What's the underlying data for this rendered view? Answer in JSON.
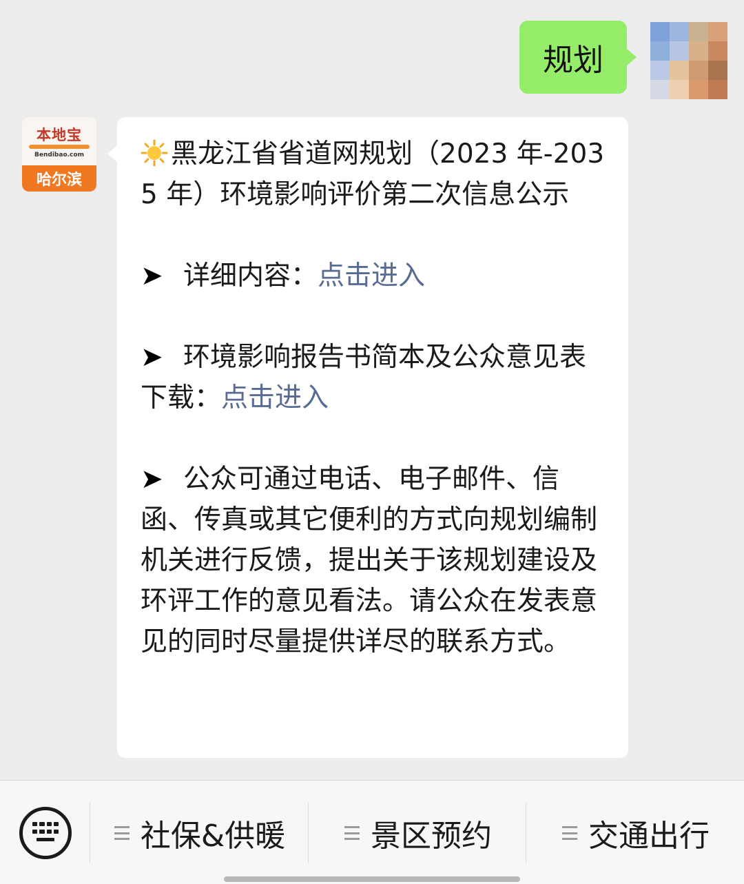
{
  "outgoing": {
    "text": "规划",
    "bubble_color": "#95ec69"
  },
  "official_account": {
    "brand": "本地宝",
    "domain": "Bendibao.com",
    "city": "哈尔滨",
    "brand_color": "#f07820"
  },
  "incoming": {
    "title_icon": "sun-icon",
    "title": "黑龙江省省道网规划（2023 年-2035 年）环境影响评价第二次信息公示",
    "arrow_icon": "arrow-right-icon",
    "arrow_glyph": "➤",
    "item1_label": "详细内容：",
    "item1_link": "点击进入",
    "item2_label": "环境影响报告书简本及公众意见表下载：",
    "item2_link": "点击进入",
    "item3_text": "公众可通过电话、电子邮件、信函、传真或其它便利的方式向规划编制机关进行反馈，提出关于该规划建设及环评工作的意见看法。请公众在发表意见的同时尽量提供详尽的联系方式。",
    "link_color": "#576b95"
  },
  "menu": {
    "keyboard_icon": "keyboard-icon",
    "items": [
      {
        "label": "社保&供暖",
        "icon": "menu-list-icon"
      },
      {
        "label": "景区预约",
        "icon": "menu-list-icon"
      },
      {
        "label": "交通出行",
        "icon": "menu-list-icon"
      }
    ]
  }
}
